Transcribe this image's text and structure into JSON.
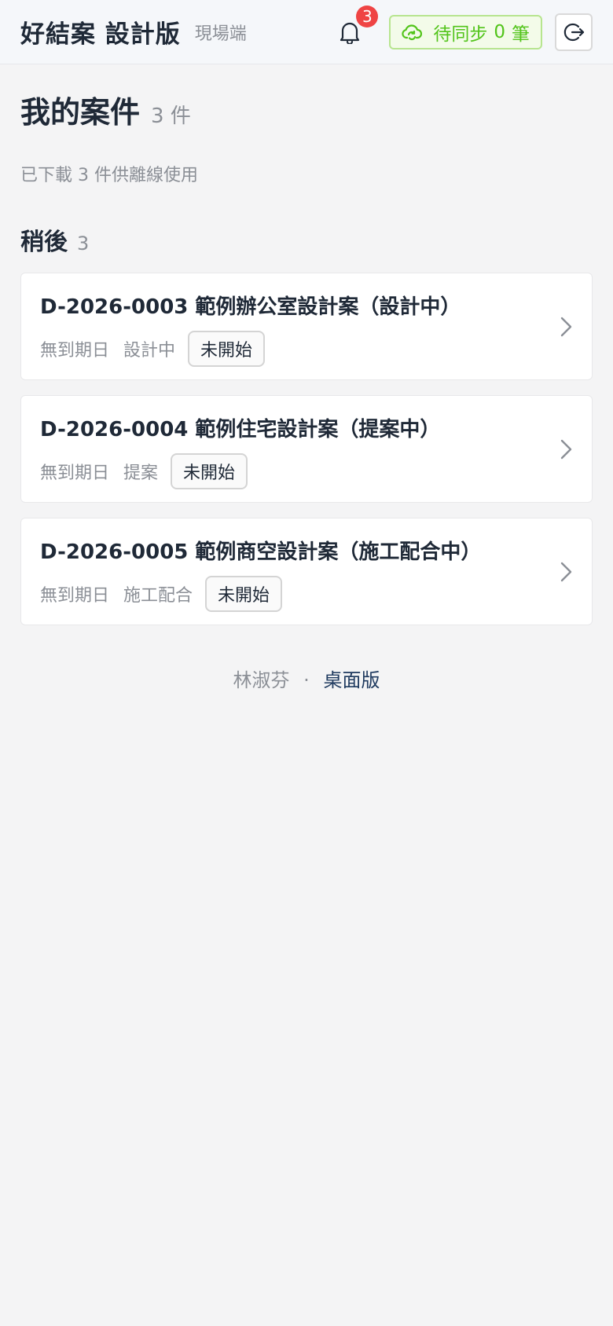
{
  "header": {
    "app_title": "好結案 設計版",
    "app_subtitle": "現場端",
    "notification_count": "3",
    "sync": {
      "label": "待同步",
      "count": "0",
      "unit": "筆"
    }
  },
  "page": {
    "title": "我的案件",
    "count": "3 件",
    "offline_note": "已下載 3 件供離線使用"
  },
  "section": {
    "title": "稍後",
    "count": "3"
  },
  "cases": [
    {
      "title": "D-2026-0003 範例辦公室設計案（設計中）",
      "due": "無到期日",
      "stage": "設計中",
      "status": "未開始"
    },
    {
      "title": "D-2026-0004 範例住宅設計案（提案中）",
      "due": "無到期日",
      "stage": "提案",
      "status": "未開始"
    },
    {
      "title": "D-2026-0005 範例商空設計案（施工配合中）",
      "due": "無到期日",
      "stage": "施工配合",
      "status": "未開始"
    }
  ],
  "footer": {
    "user_name": "林淑芬",
    "separator": "·",
    "desktop_link": "桌面版"
  },
  "colors": {
    "sync_green": "#52c41a",
    "badge_red": "#ef4444"
  },
  "icons": {
    "bell": "bell-icon",
    "cloud_sync": "cloud-sync-icon",
    "logout": "logout-icon",
    "chevron": "chevron-right-icon"
  }
}
